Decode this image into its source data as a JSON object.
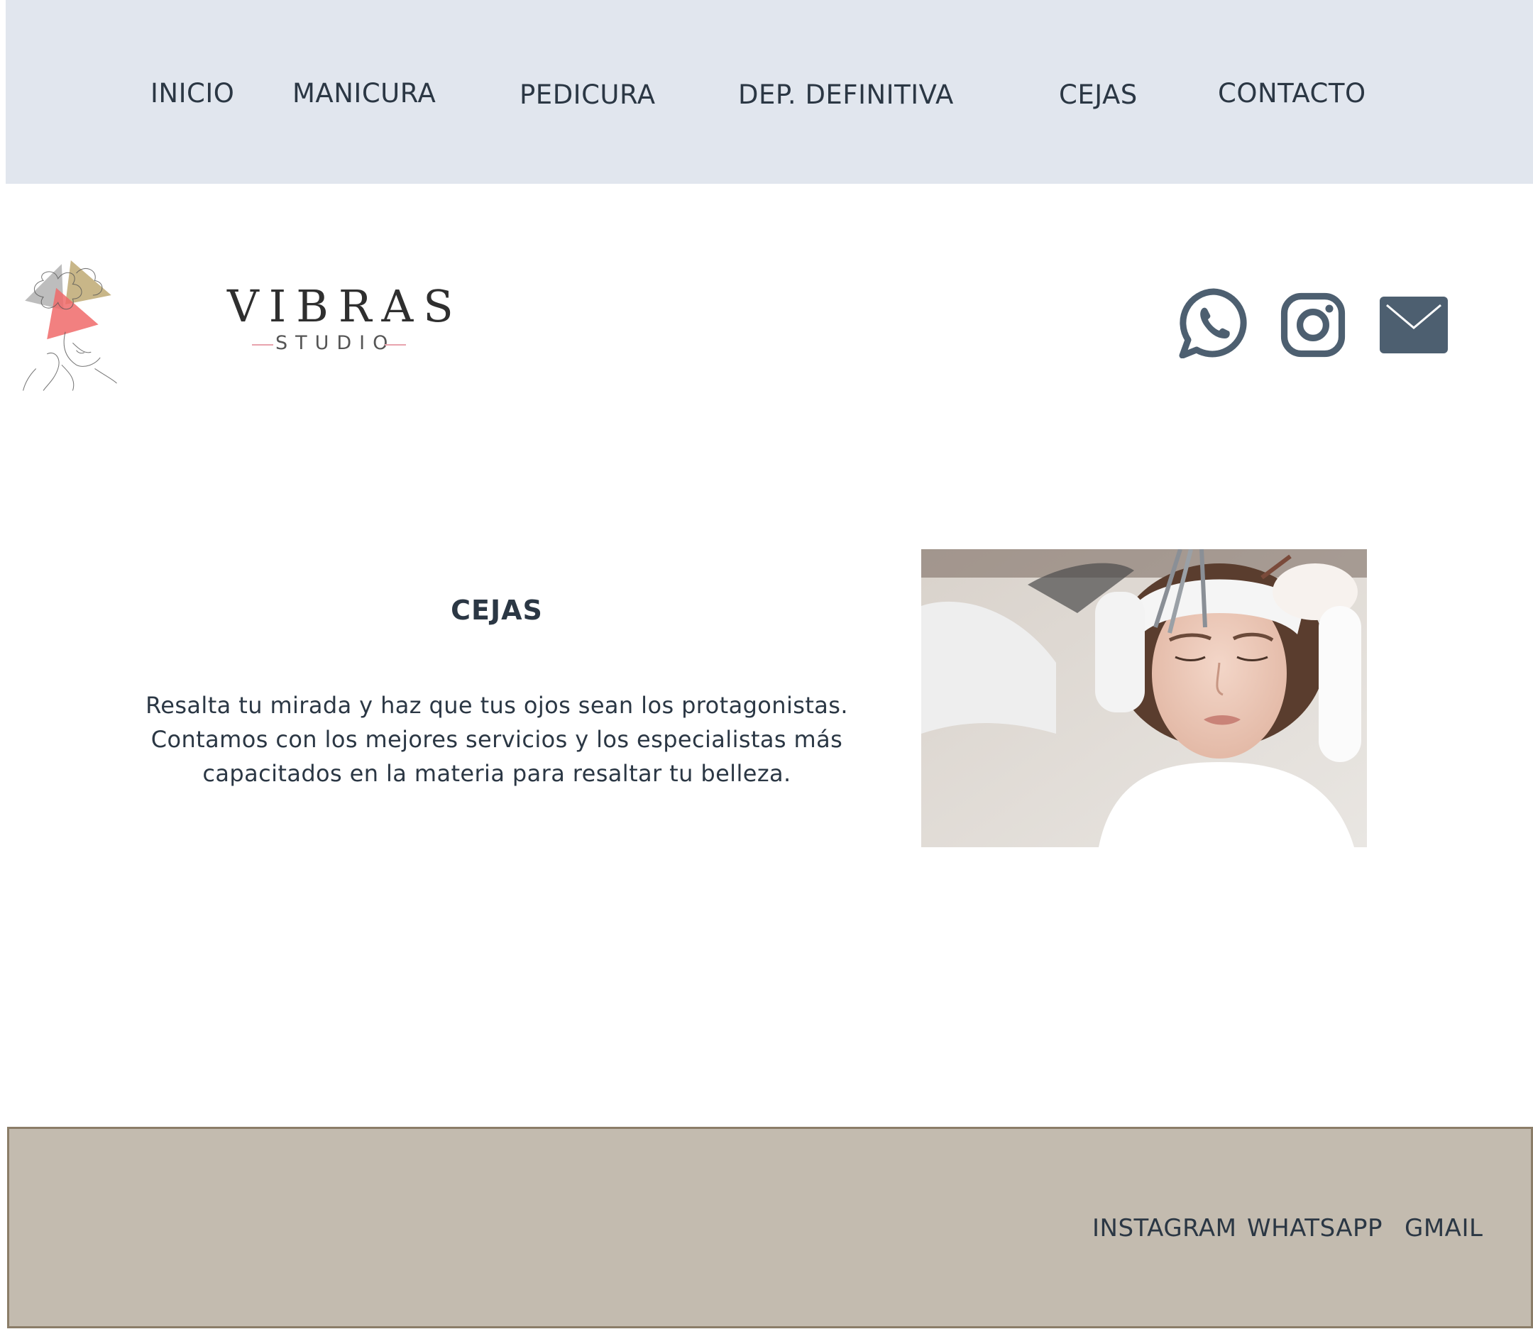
{
  "nav": {
    "items": [
      {
        "label": "INICIO"
      },
      {
        "label": "MANICURA"
      },
      {
        "label": "PEDICURA"
      },
      {
        "label": "DEP. DEFINITIVA"
      },
      {
        "label": "CEJAS"
      },
      {
        "label": "CONTACTO"
      }
    ]
  },
  "brand": {
    "name": "VIBRAS",
    "subtitle": "STUDIO"
  },
  "social_icons": [
    "whatsapp-icon",
    "instagram-icon",
    "mail-icon"
  ],
  "main": {
    "title": "CEJAS",
    "paragraph_lines": [
      "Resalta tu mirada y haz que tus ojos sean los protagonistas.",
      "Contamos con los mejores servicios y los especialistas más",
      "capacitados en la materia para resaltar tu belleza."
    ]
  },
  "footer": {
    "links": [
      {
        "label": "INSTAGRAM"
      },
      {
        "label": "WHATSAPP"
      },
      {
        "label": "GMAIL"
      }
    ]
  },
  "colors": {
    "nav_bg": "#e1e6ee",
    "text": "#2b3744",
    "icon": "#4d5f70",
    "footer_bg": "#c3bbaf",
    "footer_border": "#8b7d68"
  }
}
